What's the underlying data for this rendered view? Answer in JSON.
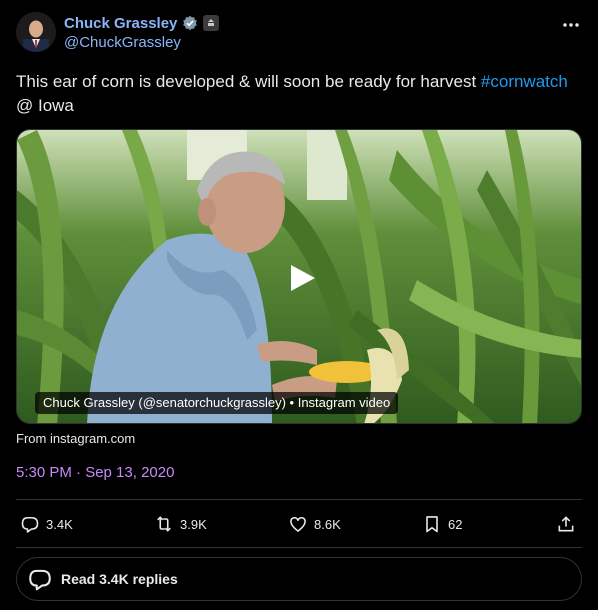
{
  "author": {
    "name": "Chuck Grassley",
    "handle": "@ChuckGrassley"
  },
  "tweet": {
    "text_before": "This ear of corn is developed & will soon be ready for harvest ",
    "hashtag": "#cornwatch",
    "text_after": "@ Iowa"
  },
  "media": {
    "caption": "Chuck Grassley (@senatorchuckgrassley) • Instagram video",
    "source": "From instagram.com"
  },
  "timestamp": "5:30 PM · Sep 13, 2020",
  "actions": {
    "replies": "3.4K",
    "reposts": "3.9K",
    "likes": "8.6K",
    "bookmarks": "62"
  },
  "read_replies": "Read 3.4K replies",
  "colors": {
    "link": "#1d9bf0",
    "name": "#8ab4f8",
    "timestamp": "#c58af9",
    "divider": "#2f3336"
  }
}
